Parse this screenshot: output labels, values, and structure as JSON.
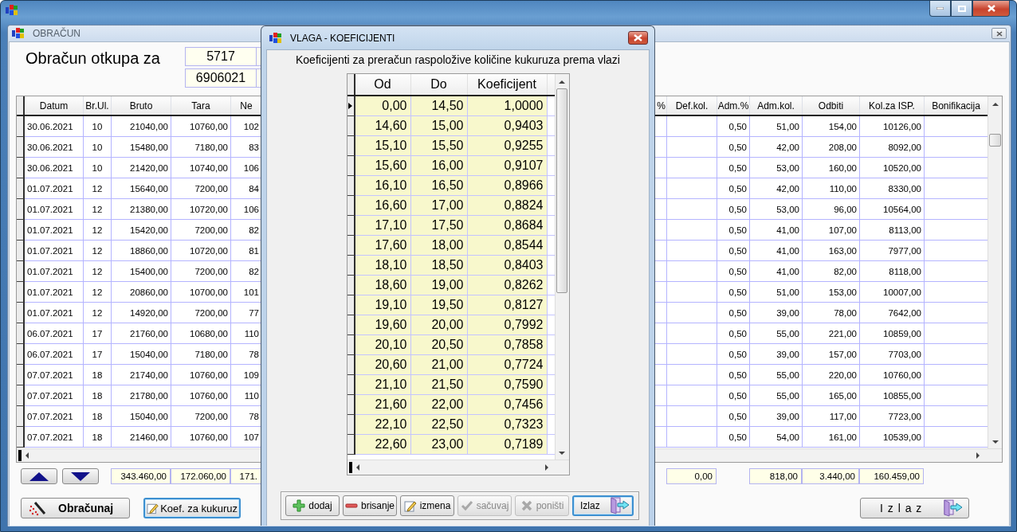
{
  "main_window": {
    "title": "OBRAČUN",
    "heading": "Obračun otkupa za",
    "fields": [
      {
        "value": "5717"
      },
      {
        "value": "6906021"
      }
    ],
    "table": {
      "columns": [
        "Datum",
        "Br.Ul.",
        "Bruto",
        "Tara",
        "Ne",
        "%",
        "Def.kol.",
        "Adm.%",
        "Adm.kol.",
        "Odbiti",
        "Kol.za ISP.",
        "Bonifikacija"
      ],
      "rows": [
        {
          "datum": "30.06.2021",
          "br_ul": "10",
          "bruto": "21040,00",
          "tara": "10760,00",
          "column_5": "102",
          "adm_pct": "0,50",
          "adm_kol": "51,00",
          "odbiti": "154,00",
          "kol_za_isp": "10126,00"
        },
        {
          "datum": "30.06.2021",
          "br_ul": "10",
          "bruto": "15480,00",
          "tara": "7180,00",
          "column_5": "83",
          "adm_pct": "0,50",
          "adm_kol": "42,00",
          "odbiti": "208,00",
          "kol_za_isp": "8092,00"
        },
        {
          "datum": "30.06.2021",
          "br_ul": "10",
          "bruto": "21420,00",
          "tara": "10740,00",
          "column_5": "106",
          "adm_pct": "0,50",
          "adm_kol": "53,00",
          "odbiti": "160,00",
          "kol_za_isp": "10520,00"
        },
        {
          "datum": "01.07.2021",
          "br_ul": "12",
          "bruto": "15640,00",
          "tara": "7200,00",
          "column_5": "84",
          "adm_pct": "0,50",
          "adm_kol": "42,00",
          "odbiti": "110,00",
          "kol_za_isp": "8330,00"
        },
        {
          "datum": "01.07.2021",
          "br_ul": "12",
          "bruto": "21380,00",
          "tara": "10720,00",
          "column_5": "106",
          "adm_pct": "0,50",
          "adm_kol": "53,00",
          "odbiti": "96,00",
          "kol_za_isp": "10564,00"
        },
        {
          "datum": "01.07.2021",
          "br_ul": "12",
          "bruto": "15420,00",
          "tara": "7200,00",
          "column_5": "82",
          "adm_pct": "0,50",
          "adm_kol": "41,00",
          "odbiti": "107,00",
          "kol_za_isp": "8113,00"
        },
        {
          "datum": "01.07.2021",
          "br_ul": "12",
          "bruto": "18860,00",
          "tara": "10720,00",
          "column_5": "81",
          "adm_pct": "0,50",
          "adm_kol": "41,00",
          "odbiti": "163,00",
          "kol_za_isp": "7977,00"
        },
        {
          "datum": "01.07.2021",
          "br_ul": "12",
          "bruto": "15400,00",
          "tara": "7200,00",
          "column_5": "82",
          "adm_pct": "0,50",
          "adm_kol": "41,00",
          "odbiti": "82,00",
          "kol_za_isp": "8118,00"
        },
        {
          "datum": "01.07.2021",
          "br_ul": "12",
          "bruto": "20860,00",
          "tara": "10700,00",
          "column_5": "101",
          "adm_pct": "0,50",
          "adm_kol": "51,00",
          "odbiti": "153,00",
          "kol_za_isp": "10007,00"
        },
        {
          "datum": "01.07.2021",
          "br_ul": "12",
          "bruto": "14920,00",
          "tara": "7200,00",
          "column_5": "77",
          "adm_pct": "0,50",
          "adm_kol": "39,00",
          "odbiti": "78,00",
          "kol_za_isp": "7642,00"
        },
        {
          "datum": "06.07.2021",
          "br_ul": "17",
          "bruto": "21760,00",
          "tara": "10680,00",
          "column_5": "110",
          "adm_pct": "0,50",
          "adm_kol": "55,00",
          "odbiti": "221,00",
          "kol_za_isp": "10859,00"
        },
        {
          "datum": "06.07.2021",
          "br_ul": "17",
          "bruto": "15040,00",
          "tara": "7180,00",
          "column_5": "78",
          "adm_pct": "0,50",
          "adm_kol": "39,00",
          "odbiti": "157,00",
          "kol_za_isp": "7703,00"
        },
        {
          "datum": "07.07.2021",
          "br_ul": "18",
          "bruto": "21740,00",
          "tara": "10760,00",
          "column_5": "109",
          "adm_pct": "0,50",
          "adm_kol": "55,00",
          "odbiti": "220,00",
          "kol_za_isp": "10760,00"
        },
        {
          "datum": "07.07.2021",
          "br_ul": "18",
          "bruto": "21780,00",
          "tara": "10760,00",
          "column_5": "110",
          "adm_pct": "0,50",
          "adm_kol": "55,00",
          "odbiti": "165,00",
          "kol_za_isp": "10855,00"
        },
        {
          "datum": "07.07.2021",
          "br_ul": "18",
          "bruto": "15040,00",
          "tara": "7200,00",
          "column_5": "78",
          "adm_pct": "0,50",
          "adm_kol": "39,00",
          "odbiti": "117,00",
          "kol_za_isp": "7723,00"
        },
        {
          "datum": "07.07.2021",
          "br_ul": "18",
          "bruto": "21460,00",
          "tara": "10760,00",
          "column_5": "107",
          "adm_pct": "0,50",
          "adm_kol": "54,00",
          "odbiti": "161,00",
          "kol_za_isp": "10539,00"
        }
      ]
    },
    "totals": {
      "bruto": "343.460,00",
      "tara": "172.060,00",
      "column_5": "171.",
      "def_kol": "0,00",
      "adm_kol": "818,00",
      "odbiti": "3.440,00",
      "kol_za_isp": "160.459,00"
    },
    "buttons": [
      {
        "label": "Obračunaj",
        "focused": false
      },
      {
        "label": "Koef. za kukuruz",
        "focused": true
      },
      {
        "label": "I z l a z",
        "focused": false
      }
    ]
  },
  "dialog": {
    "title": "VLAGA - KOEFICIJENTI",
    "subtitle": "Koeficijenti za preračun raspoložive količine kukuruza prema vlazi",
    "table": {
      "columns": [
        "Od",
        "Do",
        "Koeficijent"
      ],
      "rows": [
        {
          "od": "0,00",
          "do": "14,50",
          "koeficijent": "1,0000",
          "selected": true
        },
        {
          "od": "14,60",
          "do": "15,00",
          "koeficijent": "0,9403",
          "selected": false
        },
        {
          "od": "15,10",
          "do": "15,50",
          "koeficijent": "0,9255",
          "selected": false
        },
        {
          "od": "15,60",
          "do": "16,00",
          "koeficijent": "0,9107",
          "selected": false
        },
        {
          "od": "16,10",
          "do": "16,50",
          "koeficijent": "0,8966",
          "selected": false
        },
        {
          "od": "16,60",
          "do": "17,00",
          "koeficijent": "0,8824",
          "selected": false
        },
        {
          "od": "17,10",
          "do": "17,50",
          "koeficijent": "0,8684",
          "selected": false
        },
        {
          "od": "17,60",
          "do": "18,00",
          "koeficijent": "0,8544",
          "selected": false
        },
        {
          "od": "18,10",
          "do": "18,50",
          "koeficijent": "0,8403",
          "selected": false
        },
        {
          "od": "18,60",
          "do": "19,00",
          "koeficijent": "0,8262",
          "selected": false
        },
        {
          "od": "19,10",
          "do": "19,50",
          "koeficijent": "0,8127",
          "selected": false
        },
        {
          "od": "19,60",
          "do": "20,00",
          "koeficijent": "0,7992",
          "selected": false
        },
        {
          "od": "20,10",
          "do": "20,50",
          "koeficijent": "0,7858",
          "selected": false
        },
        {
          "od": "20,60",
          "do": "21,00",
          "koeficijent": "0,7724",
          "selected": false
        },
        {
          "od": "21,10",
          "do": "21,50",
          "koeficijent": "0,7590",
          "selected": false
        },
        {
          "od": "21,60",
          "do": "22,00",
          "koeficijent": "0,7456",
          "selected": false
        },
        {
          "od": "22,10",
          "do": "22,50",
          "koeficijent": "0,7323",
          "selected": false
        },
        {
          "od": "22,60",
          "do": "23,00",
          "koeficijent": "0,7189",
          "selected": false
        }
      ]
    },
    "buttons": [
      {
        "label": "dodaj",
        "disabled": false,
        "focused": false
      },
      {
        "label": "brisanje",
        "disabled": false,
        "focused": false
      },
      {
        "label": "izmena",
        "disabled": false,
        "focused": false
      },
      {
        "label": "sačuvaj",
        "disabled": true,
        "focused": false
      },
      {
        "label": "poništi",
        "disabled": true,
        "focused": false
      },
      {
        "label": "Izlaz",
        "disabled": false,
        "focused": true
      }
    ]
  }
}
